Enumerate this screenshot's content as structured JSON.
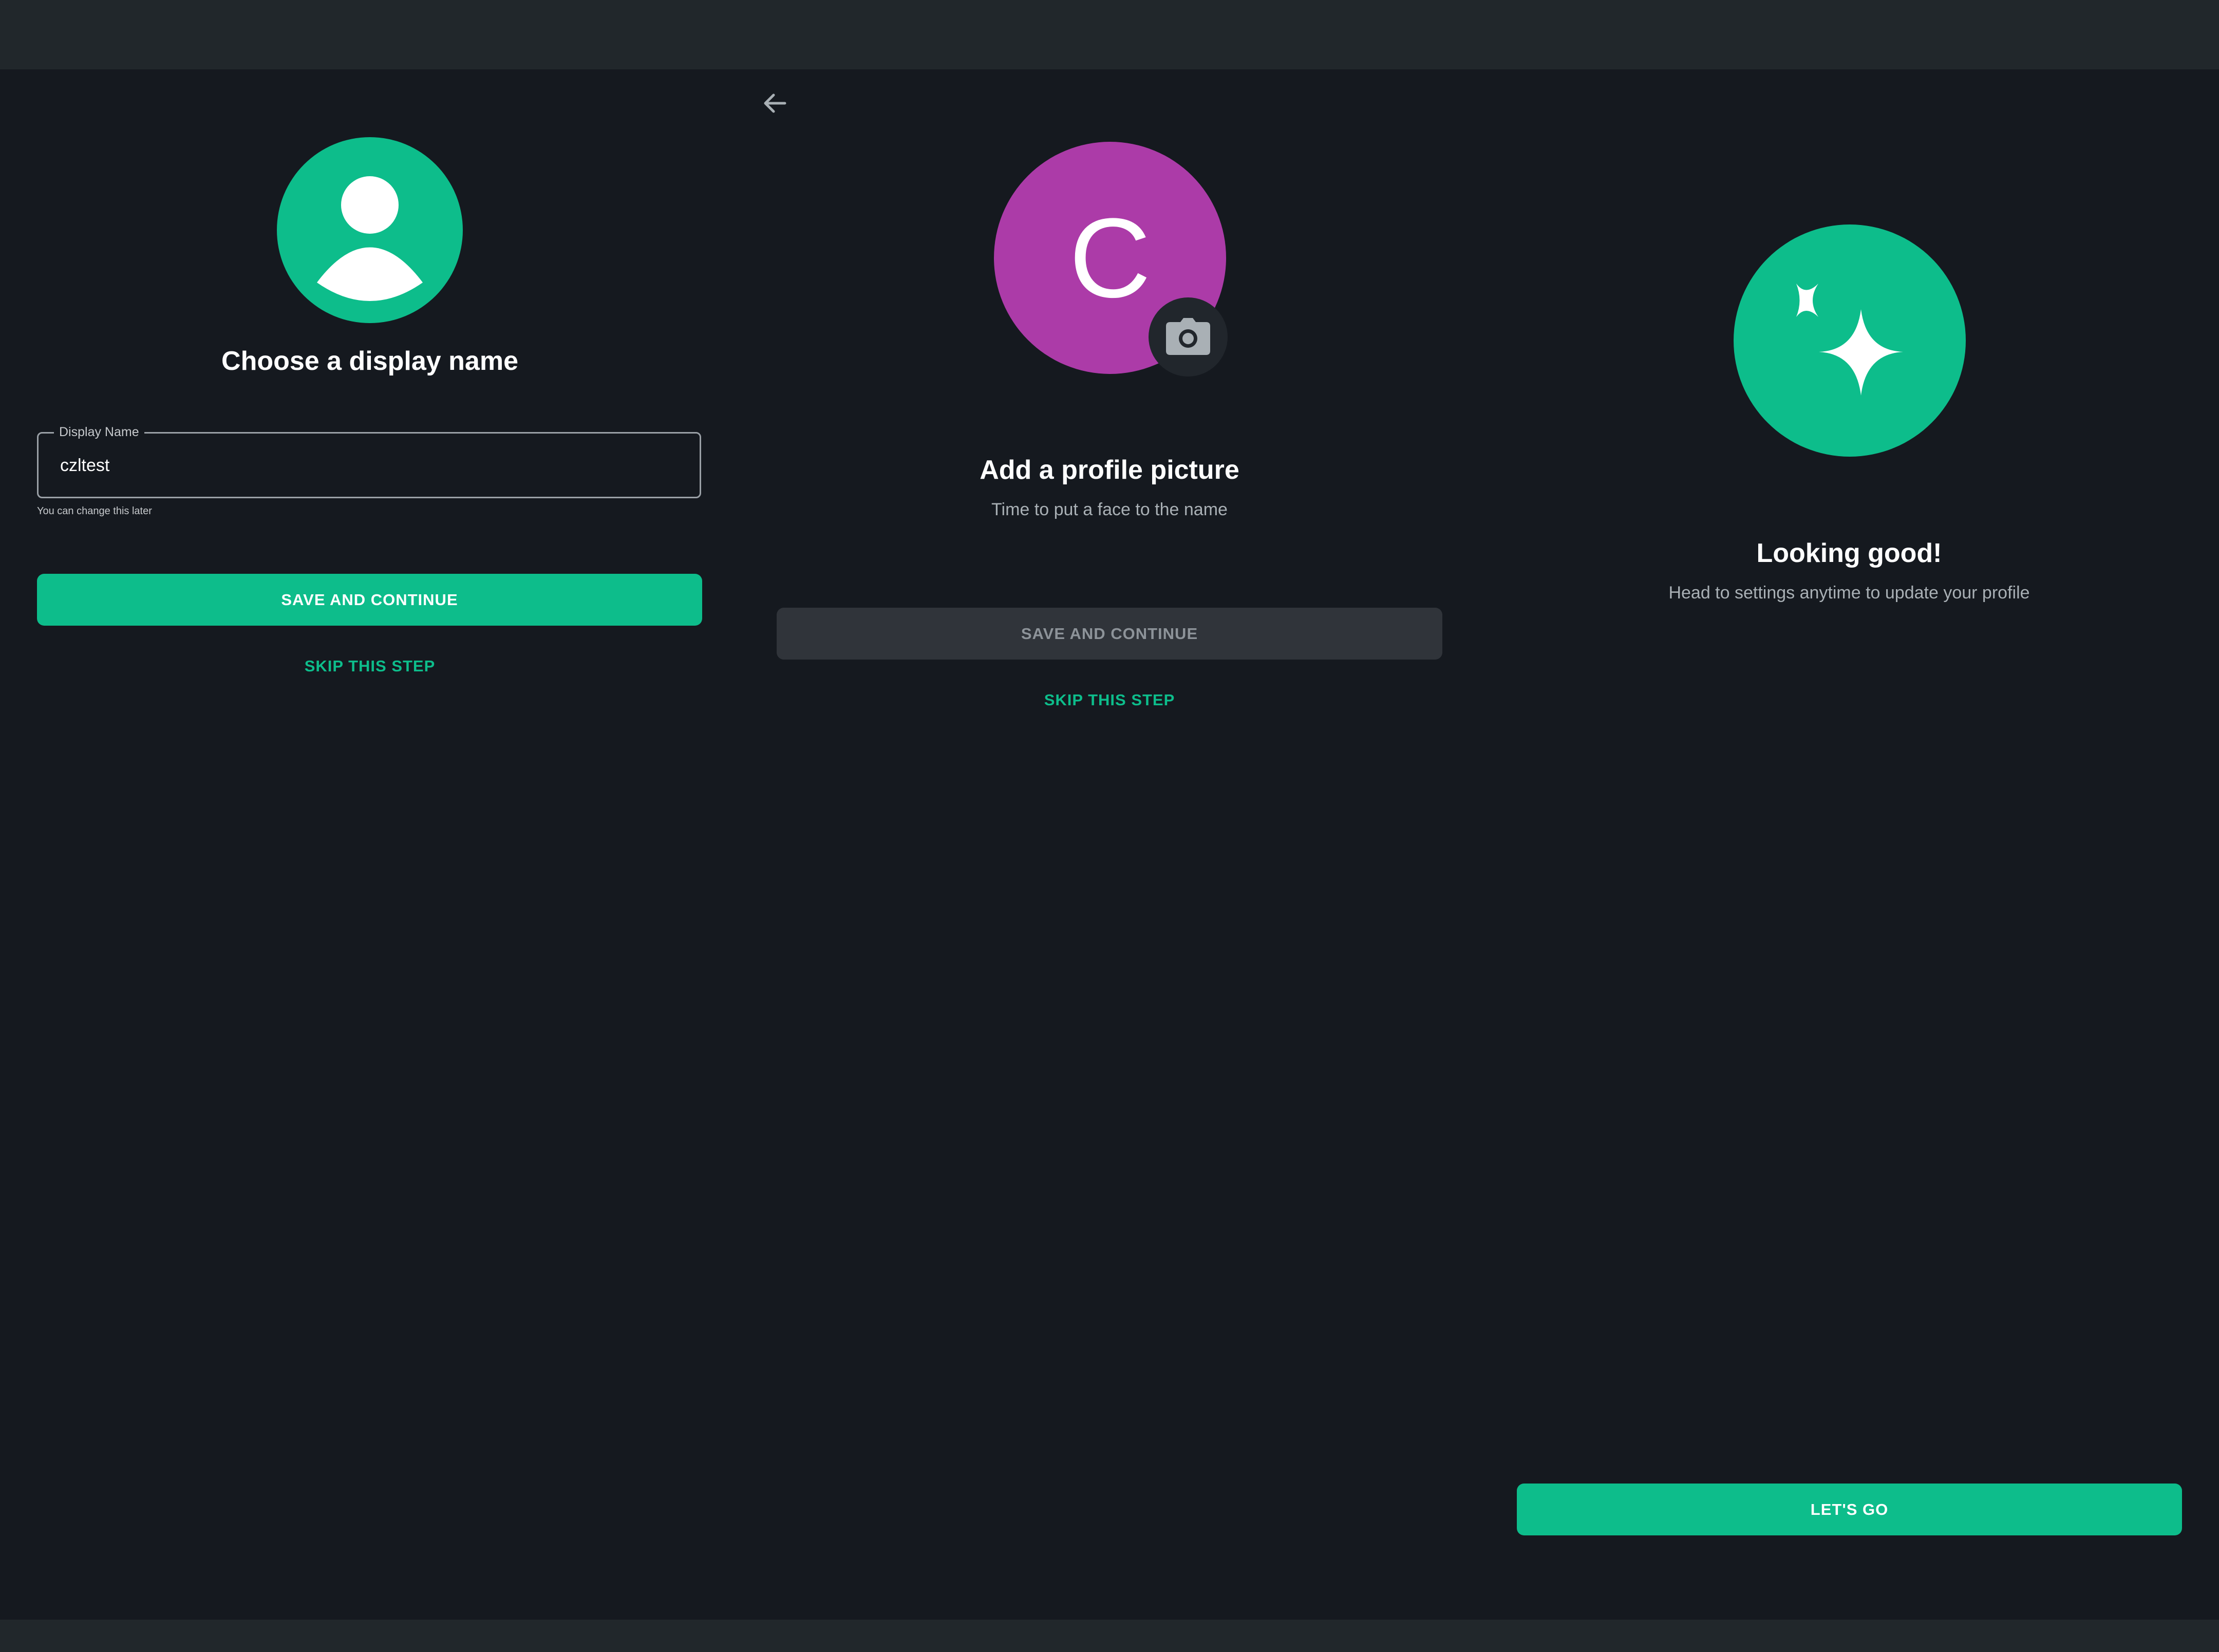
{
  "step1": {
    "avatar_icon": "person-icon",
    "title": "Choose a display name",
    "field_label": "Display Name",
    "field_value": "czltest",
    "helper": "You can change this later",
    "save_label": "SAVE AND CONTINUE",
    "skip_label": "SKIP THIS STEP"
  },
  "step2": {
    "back_icon": "arrow-left-icon",
    "avatar_letter": "C",
    "avatar_color": "#ac3ba8",
    "camera_icon": "camera-icon",
    "title": "Add a profile picture",
    "subtitle": "Time to put a face to the name",
    "save_label": "SAVE AND CONTINUE",
    "skip_label": "SKIP THIS STEP"
  },
  "step3": {
    "icon": "sparkles-icon",
    "title": "Looking good!",
    "subtitle": "Head to settings anytime to update your profile",
    "cta_label": "LET'S GO"
  },
  "colors": {
    "accent": "#0dbd8b",
    "background": "#15191f",
    "bars": "#21272b",
    "disabled_button": "#30343a"
  }
}
